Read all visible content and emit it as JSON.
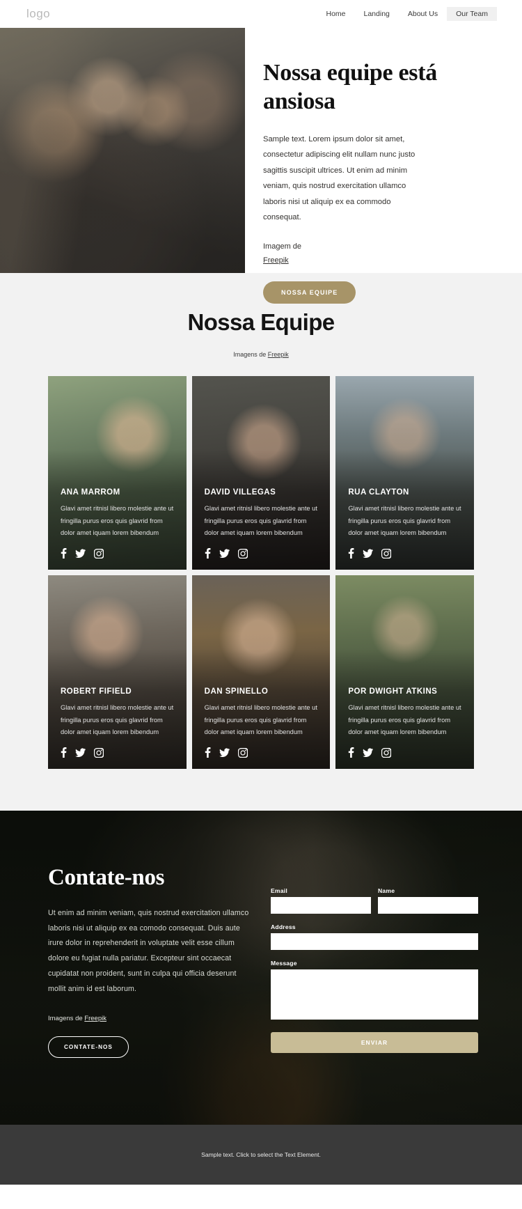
{
  "header": {
    "logo": "logo",
    "nav": [
      {
        "label": "Home",
        "active": false
      },
      {
        "label": "Landing",
        "active": false
      },
      {
        "label": "About Us",
        "active": false
      },
      {
        "label": "Our Team",
        "active": true
      }
    ]
  },
  "hero": {
    "title": "Nossa equipe está ansiosa",
    "body": "Sample text. Lorem ipsum dolor sit amet, consectetur adipiscing elit nullam nunc justo sagittis suscipit ultrices. Ut enim ad minim veniam, quis nostrud exercitation ullamco laboris nisi ut aliquip ex ea commodo consequat.",
    "credit_prefix": "Imagem de",
    "credit_link": "Freepik",
    "cta_label": "NOSSA EQUIPE",
    "accent_color": "#a79468"
  },
  "team": {
    "title": "Nossa Equipe",
    "subtitle_prefix": "Imagens de ",
    "subtitle_link": "Freepik",
    "members": [
      {
        "name": "ANA MARROM",
        "desc": "Glavi amet ritnisl libero molestie ante ut fringilla purus eros quis glavrid from dolor amet iquam lorem bibendum"
      },
      {
        "name": "DAVID VILLEGAS",
        "desc": "Glavi amet ritnisl libero molestie ante ut fringilla purus eros quis glavrid from dolor amet iquam lorem bibendum"
      },
      {
        "name": "RUA CLAYTON",
        "desc": "Glavi amet ritnisl libero molestie ante ut fringilla purus eros quis glavrid from dolor amet iquam lorem bibendum"
      },
      {
        "name": "ROBERT FIFIELD",
        "desc": "Glavi amet ritnisl libero molestie ante ut fringilla purus eros quis glavrid from dolor amet iquam lorem bibendum"
      },
      {
        "name": "DAN SPINELLO",
        "desc": "Glavi amet ritnisl libero molestie ante ut fringilla purus eros quis glavrid from dolor amet iquam lorem bibendum"
      },
      {
        "name": "POR DWIGHT ATKINS",
        "desc": "Glavi amet ritnisl libero molestie ante ut fringilla purus eros quis glavrid from dolor amet iquam lorem bibendum"
      }
    ],
    "social_icons": [
      "facebook-icon",
      "twitter-icon",
      "instagram-icon"
    ]
  },
  "contact": {
    "title": "Contate-nos",
    "body": "Ut enim ad minim veniam, quis nostrud exercitation ullamco laboris nisi ut aliquip ex ea comodo consequat. Duis aute irure dolor in reprehenderit in voluptate velit esse cillum dolore eu fugiat nulla pariatur. Excepteur sint occaecat cupidatat non proident, sunt in culpa qui officia deserunt mollit anim id est laborum.",
    "credit_prefix": "Imagens de ",
    "credit_link": "Freepik",
    "cta_label": "CONTATE-NOS",
    "form": {
      "email_label": "Email",
      "email_value": "",
      "email_placeholder": "",
      "name_label": "Name",
      "name_value": "",
      "name_placeholder": "",
      "address_label": "Address",
      "address_value": "",
      "address_placeholder": "",
      "message_label": "Message",
      "message_value": "",
      "message_placeholder": "",
      "submit_label": "ENVIAR",
      "submit_color": "#c8bc96"
    }
  },
  "footer": {
    "text": "Sample text. Click to select the Text Element."
  }
}
